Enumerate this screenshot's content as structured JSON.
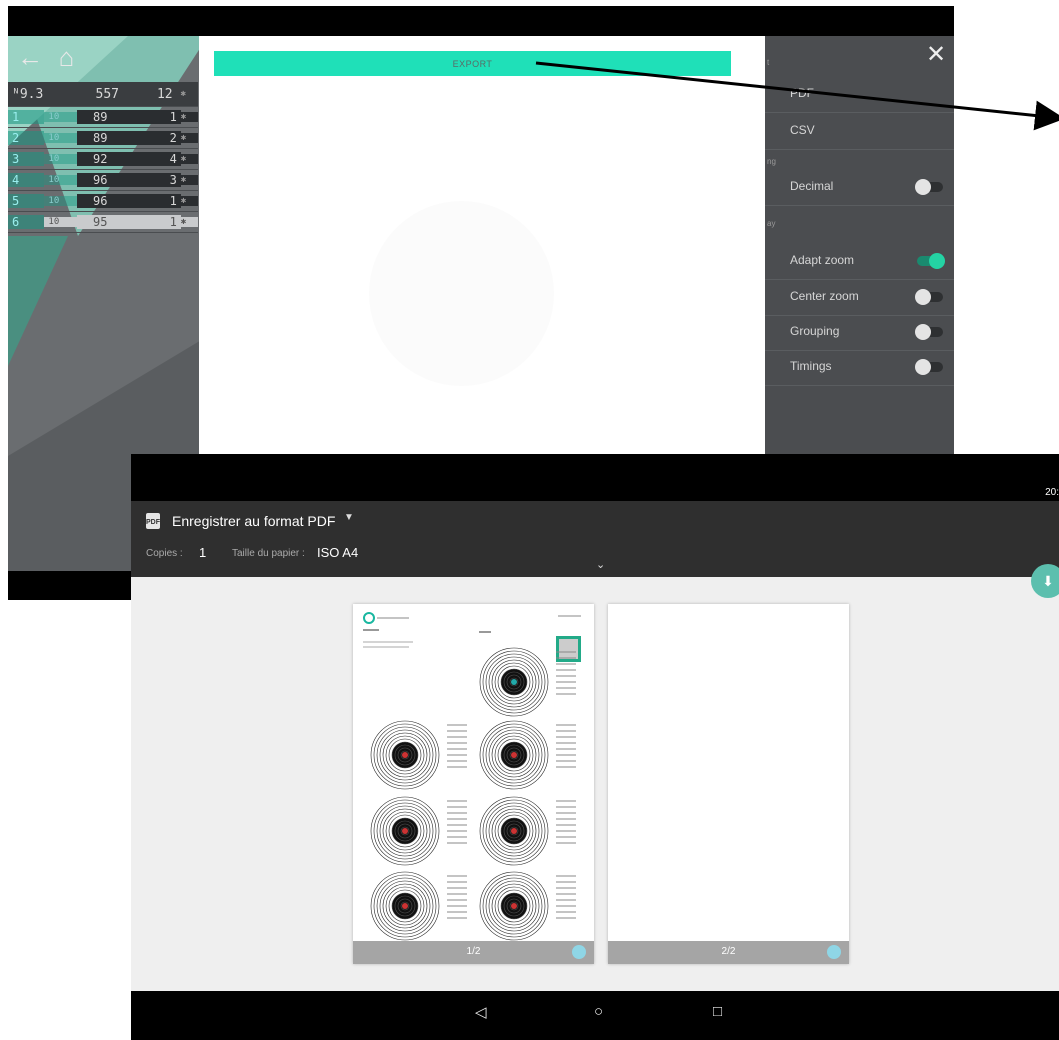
{
  "app": {
    "score_table": {
      "header": {
        "series": "ᴺ9.3",
        "total": "557",
        "count": "12"
      },
      "rows": [
        {
          "idx": "1",
          "ten": "10",
          "score": "89",
          "count": "1"
        },
        {
          "idx": "2",
          "ten": "10",
          "score": "89",
          "count": "2"
        },
        {
          "idx": "3",
          "ten": "10",
          "score": "92",
          "count": "4"
        },
        {
          "idx": "4",
          "ten": "10",
          "score": "96",
          "count": "3"
        },
        {
          "idx": "5",
          "ten": "10",
          "score": "96",
          "count": "1"
        },
        {
          "idx": "6",
          "ten": "10",
          "score": "95",
          "count": "1"
        }
      ]
    },
    "settings": {
      "items": [
        {
          "label": "PDF"
        },
        {
          "label": "CSV"
        },
        {
          "label": "Decimal",
          "on": false
        },
        {
          "label": "Adapt zoom",
          "on": true
        },
        {
          "label": "Center zoom",
          "on": false
        },
        {
          "label": "Grouping",
          "on": false
        },
        {
          "label": "Timings",
          "on": false
        }
      ],
      "sections": [
        "t",
        "ng",
        "ay"
      ]
    },
    "export_dialog": {
      "button_label": "EXPORT"
    },
    "colors": {
      "accent": "#1fe0b8",
      "toggle_on": "#24d3a4",
      "panel": "#4b4d50"
    }
  },
  "print_preview": {
    "status_time": "20:",
    "printer": {
      "icon_label": "PDF",
      "name": "Enregistrer au format PDF"
    },
    "copies": {
      "label": "Copies :",
      "value": "1"
    },
    "paper": {
      "label": "Taille du papier :",
      "value": "ISO A4"
    },
    "pages": [
      {
        "number": "1/2"
      },
      {
        "number": "2/2"
      }
    ]
  }
}
